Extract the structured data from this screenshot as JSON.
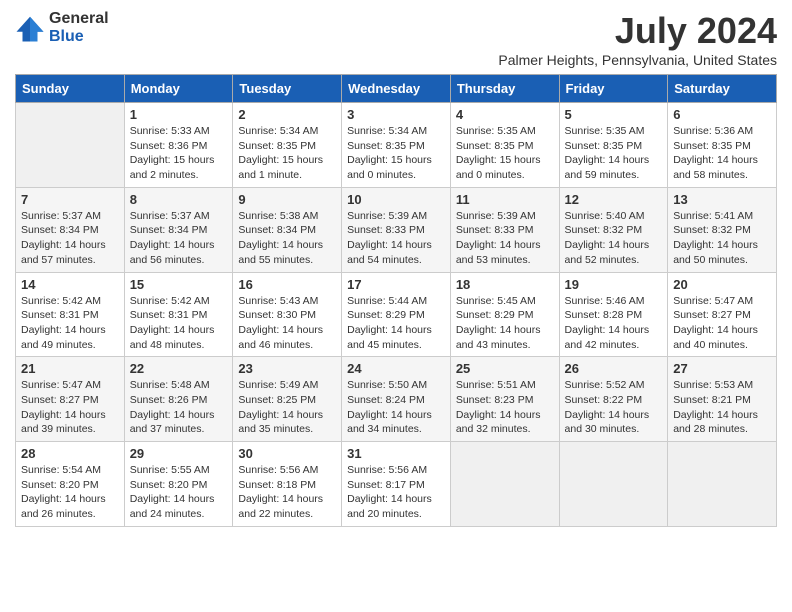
{
  "header": {
    "logo_general": "General",
    "logo_blue": "Blue",
    "month_title": "July 2024",
    "location": "Palmer Heights, Pennsylvania, United States"
  },
  "days_of_week": [
    "Sunday",
    "Monday",
    "Tuesday",
    "Wednesday",
    "Thursday",
    "Friday",
    "Saturday"
  ],
  "weeks": [
    [
      {
        "day": "",
        "info": ""
      },
      {
        "day": "1",
        "info": "Sunrise: 5:33 AM\nSunset: 8:36 PM\nDaylight: 15 hours\nand 2 minutes."
      },
      {
        "day": "2",
        "info": "Sunrise: 5:34 AM\nSunset: 8:35 PM\nDaylight: 15 hours\nand 1 minute."
      },
      {
        "day": "3",
        "info": "Sunrise: 5:34 AM\nSunset: 8:35 PM\nDaylight: 15 hours\nand 0 minutes."
      },
      {
        "day": "4",
        "info": "Sunrise: 5:35 AM\nSunset: 8:35 PM\nDaylight: 15 hours\nand 0 minutes."
      },
      {
        "day": "5",
        "info": "Sunrise: 5:35 AM\nSunset: 8:35 PM\nDaylight: 14 hours\nand 59 minutes."
      },
      {
        "day": "6",
        "info": "Sunrise: 5:36 AM\nSunset: 8:35 PM\nDaylight: 14 hours\nand 58 minutes."
      }
    ],
    [
      {
        "day": "7",
        "info": "Sunrise: 5:37 AM\nSunset: 8:34 PM\nDaylight: 14 hours\nand 57 minutes."
      },
      {
        "day": "8",
        "info": "Sunrise: 5:37 AM\nSunset: 8:34 PM\nDaylight: 14 hours\nand 56 minutes."
      },
      {
        "day": "9",
        "info": "Sunrise: 5:38 AM\nSunset: 8:34 PM\nDaylight: 14 hours\nand 55 minutes."
      },
      {
        "day": "10",
        "info": "Sunrise: 5:39 AM\nSunset: 8:33 PM\nDaylight: 14 hours\nand 54 minutes."
      },
      {
        "day": "11",
        "info": "Sunrise: 5:39 AM\nSunset: 8:33 PM\nDaylight: 14 hours\nand 53 minutes."
      },
      {
        "day": "12",
        "info": "Sunrise: 5:40 AM\nSunset: 8:32 PM\nDaylight: 14 hours\nand 52 minutes."
      },
      {
        "day": "13",
        "info": "Sunrise: 5:41 AM\nSunset: 8:32 PM\nDaylight: 14 hours\nand 50 minutes."
      }
    ],
    [
      {
        "day": "14",
        "info": "Sunrise: 5:42 AM\nSunset: 8:31 PM\nDaylight: 14 hours\nand 49 minutes."
      },
      {
        "day": "15",
        "info": "Sunrise: 5:42 AM\nSunset: 8:31 PM\nDaylight: 14 hours\nand 48 minutes."
      },
      {
        "day": "16",
        "info": "Sunrise: 5:43 AM\nSunset: 8:30 PM\nDaylight: 14 hours\nand 46 minutes."
      },
      {
        "day": "17",
        "info": "Sunrise: 5:44 AM\nSunset: 8:29 PM\nDaylight: 14 hours\nand 45 minutes."
      },
      {
        "day": "18",
        "info": "Sunrise: 5:45 AM\nSunset: 8:29 PM\nDaylight: 14 hours\nand 43 minutes."
      },
      {
        "day": "19",
        "info": "Sunrise: 5:46 AM\nSunset: 8:28 PM\nDaylight: 14 hours\nand 42 minutes."
      },
      {
        "day": "20",
        "info": "Sunrise: 5:47 AM\nSunset: 8:27 PM\nDaylight: 14 hours\nand 40 minutes."
      }
    ],
    [
      {
        "day": "21",
        "info": "Sunrise: 5:47 AM\nSunset: 8:27 PM\nDaylight: 14 hours\nand 39 minutes."
      },
      {
        "day": "22",
        "info": "Sunrise: 5:48 AM\nSunset: 8:26 PM\nDaylight: 14 hours\nand 37 minutes."
      },
      {
        "day": "23",
        "info": "Sunrise: 5:49 AM\nSunset: 8:25 PM\nDaylight: 14 hours\nand 35 minutes."
      },
      {
        "day": "24",
        "info": "Sunrise: 5:50 AM\nSunset: 8:24 PM\nDaylight: 14 hours\nand 34 minutes."
      },
      {
        "day": "25",
        "info": "Sunrise: 5:51 AM\nSunset: 8:23 PM\nDaylight: 14 hours\nand 32 minutes."
      },
      {
        "day": "26",
        "info": "Sunrise: 5:52 AM\nSunset: 8:22 PM\nDaylight: 14 hours\nand 30 minutes."
      },
      {
        "day": "27",
        "info": "Sunrise: 5:53 AM\nSunset: 8:21 PM\nDaylight: 14 hours\nand 28 minutes."
      }
    ],
    [
      {
        "day": "28",
        "info": "Sunrise: 5:54 AM\nSunset: 8:20 PM\nDaylight: 14 hours\nand 26 minutes."
      },
      {
        "day": "29",
        "info": "Sunrise: 5:55 AM\nSunset: 8:20 PM\nDaylight: 14 hours\nand 24 minutes."
      },
      {
        "day": "30",
        "info": "Sunrise: 5:56 AM\nSunset: 8:18 PM\nDaylight: 14 hours\nand 22 minutes."
      },
      {
        "day": "31",
        "info": "Sunrise: 5:56 AM\nSunset: 8:17 PM\nDaylight: 14 hours\nand 20 minutes."
      },
      {
        "day": "",
        "info": ""
      },
      {
        "day": "",
        "info": ""
      },
      {
        "day": "",
        "info": ""
      }
    ]
  ]
}
